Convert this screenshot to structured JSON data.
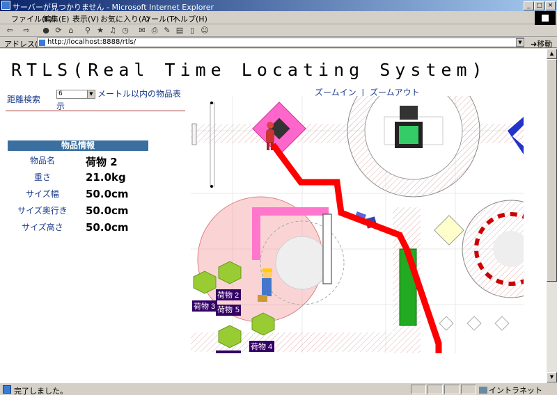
{
  "window": {
    "title": "サーバーが見つかりません - Microsoft Internet Explorer"
  },
  "menu": {
    "items": [
      "ファイル(F)",
      "編集(E)",
      "表示(V)",
      "お気に入り(A)",
      "ツール(T)",
      "ヘルプ(H)"
    ]
  },
  "address_bar": {
    "label": "アドレス(D)",
    "url": "http://localhost:8888/rtls/",
    "go_label": "移動"
  },
  "page": {
    "title": "RTLS(Real Time Locating System)",
    "search": {
      "label": "距離検索",
      "selected_distance": "6",
      "suffix_line1": "メートル以内の物品表",
      "suffix_line2": "示"
    },
    "zoom": {
      "zoom_in": "ズームイン",
      "separator": "|",
      "zoom_out": "ズームアウト"
    },
    "item_info": {
      "header": "物品情報",
      "rows": [
        {
          "label": "物品名",
          "value": "荷物 2"
        },
        {
          "label": "重さ",
          "value": "21.0kg"
        },
        {
          "label": "サイズ幅",
          "value": "50.0cm"
        },
        {
          "label": "サイズ奥行き",
          "value": "50.0cm"
        },
        {
          "label": "サイズ高さ",
          "value": "50.0cm"
        }
      ]
    },
    "map": {
      "package_labels": [
        "荷物 2",
        "荷物 3",
        "荷物 4",
        "荷物 5"
      ],
      "colors": {
        "path": "#ff0000",
        "search_circle": "#f4a0a0",
        "package": "#99cc33",
        "label_bg": "#330066",
        "magenta_block": "#ff66cc",
        "green_block": "#22aa22",
        "blue_block": "#2233cc",
        "rack_red": "#cc0000"
      }
    }
  },
  "status_bar": {
    "text": "完了しました。",
    "zone": "イントラネット"
  }
}
